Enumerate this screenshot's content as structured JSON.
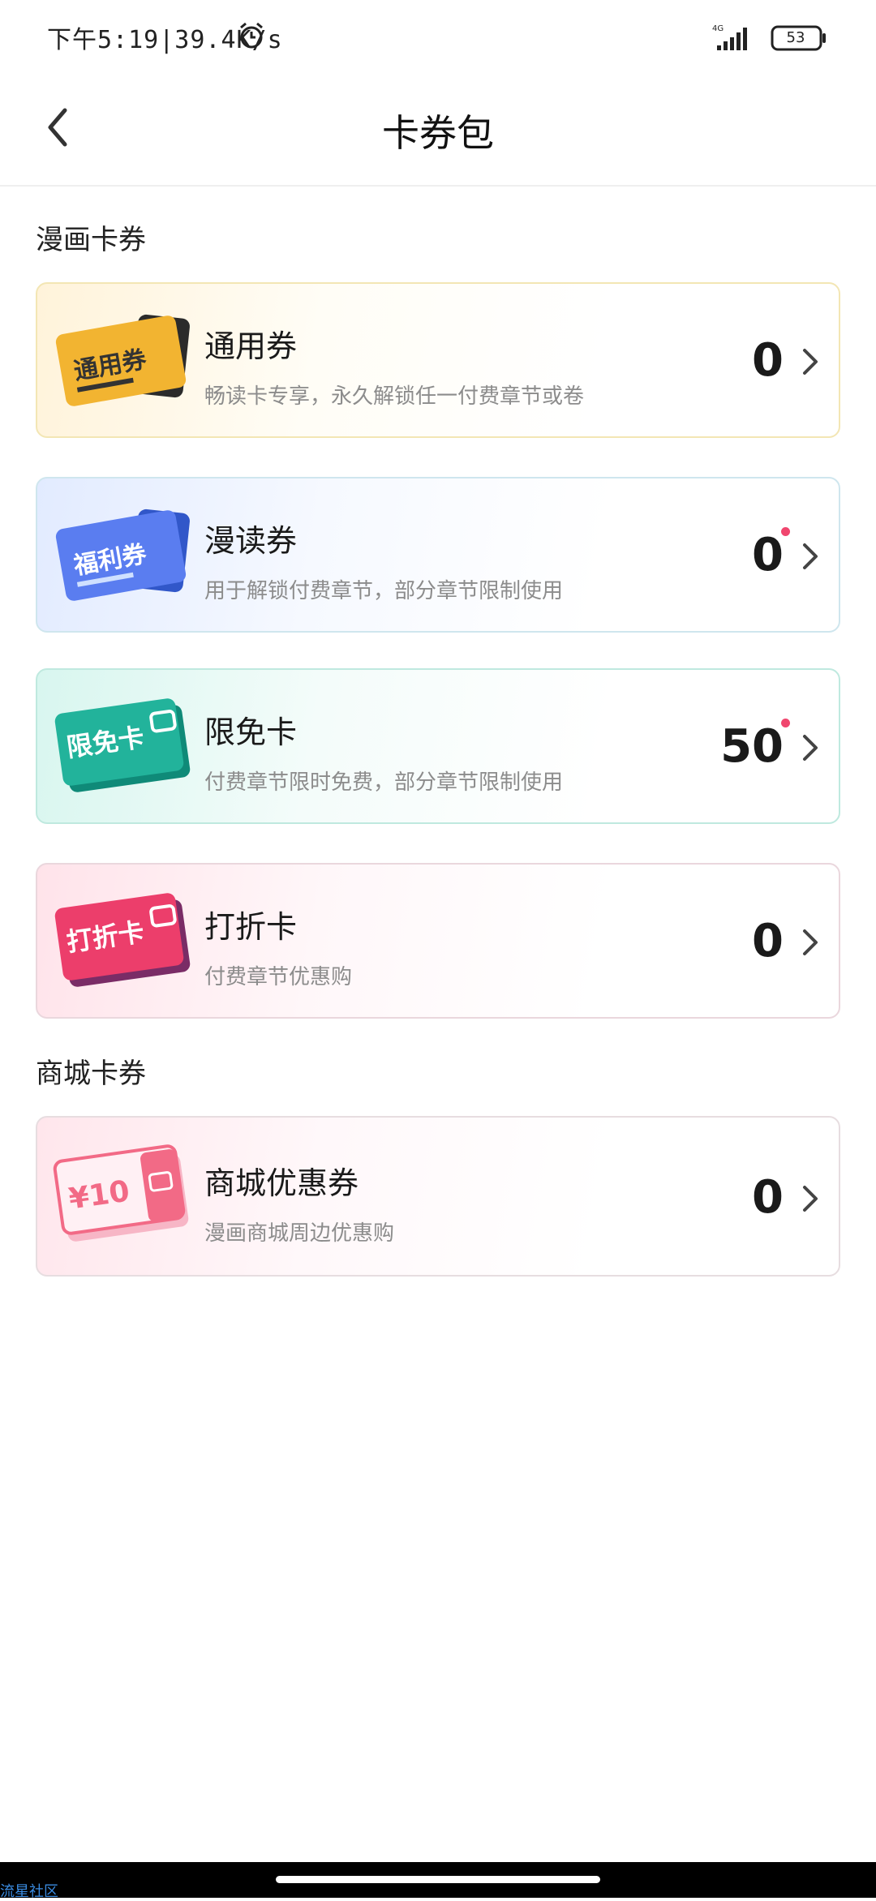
{
  "status_bar": {
    "time": "下午5:19|39.4K/s",
    "network": "4G",
    "battery": "53",
    "icons": [
      "alarm-icon",
      "signal-icon",
      "battery-icon"
    ]
  },
  "header": {
    "title": "卡券包",
    "back_icon": "chevron-left-icon"
  },
  "sections": [
    {
      "title": "漫画卡券",
      "cards": [
        {
          "art_text": "通用券",
          "name": "通用券",
          "description": "畅读卡专享，永久解锁任一付费章节或卷",
          "count": "0",
          "has_new_dot": false,
          "color": "#f2b431"
        },
        {
          "art_text": "福利券",
          "name": "漫读券",
          "description": "用于解锁付费章节，部分章节限制使用",
          "count": "0",
          "has_new_dot": true,
          "color": "#5a7df0"
        },
        {
          "art_text": "限免卡",
          "name": "限免卡",
          "description": "付费章节限时免费，部分章节限制使用",
          "count": "50",
          "has_new_dot": true,
          "color": "#22b39b"
        },
        {
          "art_text": "打折卡",
          "name": "打折卡",
          "description": "付费章节优惠购",
          "count": "0",
          "has_new_dot": false,
          "color": "#ec3e6b"
        }
      ]
    },
    {
      "title": "商城卡券",
      "cards": [
        {
          "art_text": "¥10",
          "name": "商城优惠券",
          "description": "漫画商城周边优惠购",
          "count": "0",
          "has_new_dot": false,
          "color": "#f26a86"
        }
      ]
    }
  ],
  "watermark": "流星社区"
}
